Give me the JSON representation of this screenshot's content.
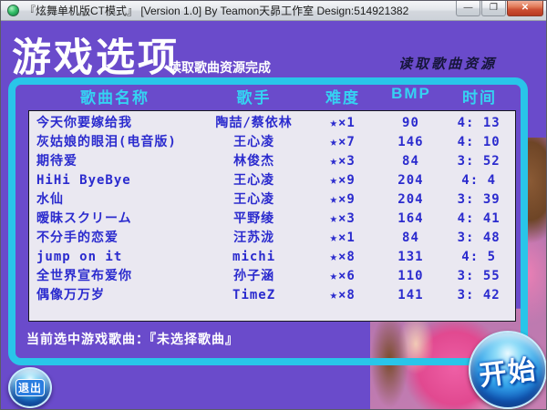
{
  "window": {
    "title": "『炫舞单机版CT模式』  [Version 1.0]  By Teamon天昴工作室 Design:514921382",
    "controls": {
      "minimize": "—",
      "maximize": "❐",
      "close": "✕"
    }
  },
  "header": {
    "title": "游戏选项",
    "load_complete": "读取歌曲资源完成",
    "load_status": "读取歌曲资源"
  },
  "table": {
    "columns": [
      "歌曲名称",
      "歌手",
      "难度",
      "BMP",
      "时间"
    ],
    "rows": [
      {
        "name": "今天你要嫁给我",
        "singer": "陶喆/蔡依林",
        "difficulty": "★×1",
        "bmp": "90",
        "time": "4: 13"
      },
      {
        "name": "灰姑娘的眼泪(电音版)",
        "singer": "王心凌",
        "difficulty": "★×7",
        "bmp": "146",
        "time": "4: 10"
      },
      {
        "name": "期待爱",
        "singer": "林俊杰",
        "difficulty": "★×3",
        "bmp": "84",
        "time": "3: 52"
      },
      {
        "name": "HiHi ByeBye",
        "singer": "王心凌",
        "difficulty": "★×9",
        "bmp": "204",
        "time": "4: 4"
      },
      {
        "name": "水仙",
        "singer": "王心凌",
        "difficulty": "★×9",
        "bmp": "204",
        "time": "3: 39"
      },
      {
        "name": "暧昧スクリーム",
        "singer": "平野绫",
        "difficulty": "★×3",
        "bmp": "164",
        "time": "4: 41"
      },
      {
        "name": "不分手的恋爱",
        "singer": "汪苏泷",
        "difficulty": "★×1",
        "bmp": "84",
        "time": "3: 48"
      },
      {
        "name": "jump on it",
        "singer": "michi",
        "difficulty": "★×8",
        "bmp": "131",
        "time": "4: 5"
      },
      {
        "name": "全世界宣布爱你",
        "singer": "孙子涵",
        "difficulty": "★×6",
        "bmp": "110",
        "time": "3: 55"
      },
      {
        "name": "偶像万万岁",
        "singer": "TimeZ",
        "difficulty": "★×8",
        "bmp": "141",
        "time": "3: 42"
      }
    ]
  },
  "footer": {
    "current_song": "当前选中游戏歌曲：『未选择歌曲』",
    "exit_label": "退出",
    "start_label": "开始"
  },
  "colors": {
    "background_purple": "#6A4BCB",
    "frame_cyan": "#29C5E9",
    "header_text_cyan": "#35D2F2",
    "row_text_blue": "#2B2BCE",
    "list_background": "#EAE8F1"
  }
}
